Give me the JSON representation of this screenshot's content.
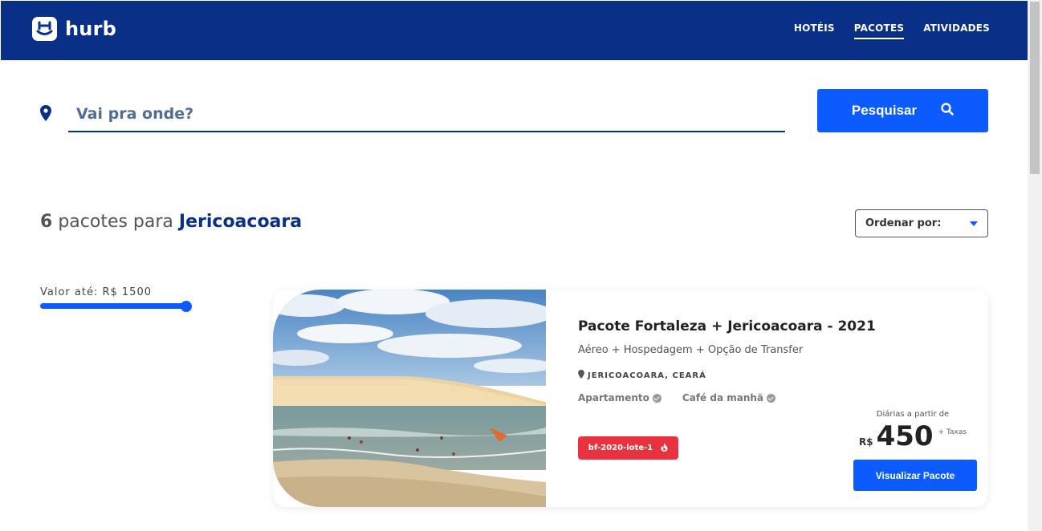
{
  "header": {
    "logo_text": "hurb",
    "nav": [
      {
        "label": "HOTÉIS",
        "active": false
      },
      {
        "label": "PACOTES",
        "active": true
      },
      {
        "label": "ATIVIDADES",
        "active": false
      }
    ],
    "bg_color": "#0a2f86"
  },
  "search": {
    "placeholder": "Vai pra onde?",
    "button_label": "Pesquisar",
    "accent": "#0b5bff"
  },
  "results": {
    "count": "6",
    "middle": "pacotes para",
    "destination": "Jericoacoara",
    "sort_label": "Ordenar por:"
  },
  "filter": {
    "label": "Valor até: R$ 1500",
    "slider_fraction": 1.0
  },
  "card": {
    "title": "Pacote Fortaleza + Jericoacoara - 2021",
    "subtitle": "Aéreo + Hospedagem + Opção de Transfer",
    "location": "JERICOACOARA, CEARÁ",
    "amenities": [
      "Apartamento",
      "Café da manhã"
    ],
    "badge": "bf-2020-lote-1",
    "price_note": "Diárias a partir de",
    "currency": "R$",
    "price": "450",
    "tax_note": "+ Taxas",
    "button_label": "Visualizar Pacote",
    "badge_color": "#e8323f"
  }
}
